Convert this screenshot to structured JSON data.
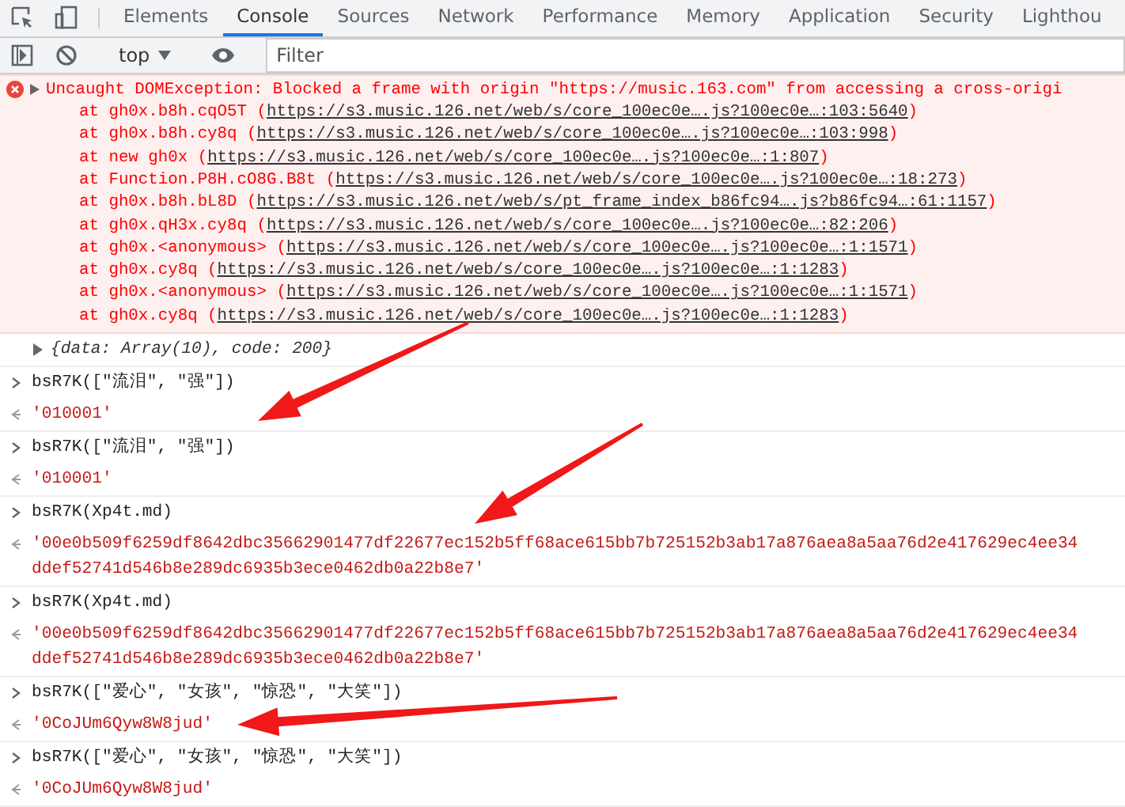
{
  "tabs": [
    {
      "label": "Elements",
      "selected": false
    },
    {
      "label": "Console",
      "selected": true
    },
    {
      "label": "Sources",
      "selected": false
    },
    {
      "label": "Network",
      "selected": false
    },
    {
      "label": "Performance",
      "selected": false
    },
    {
      "label": "Memory",
      "selected": false
    },
    {
      "label": "Application",
      "selected": false
    },
    {
      "label": "Security",
      "selected": false
    },
    {
      "label": "Lighthou",
      "selected": false
    }
  ],
  "toolbar": {
    "context": "top",
    "filter": {
      "placeholder": "Filter"
    }
  },
  "error": {
    "message": "Uncaught DOMException: Blocked a frame with origin \"https://music.163.com\" from accessing a cross-origi",
    "stack": [
      {
        "at": "at gh0x.b8h.cqO5T (",
        "link": "https://s3.music.126.net/web/s/core_100ec0e….js?100ec0e…:103:5640",
        "close": ")"
      },
      {
        "at": "at gh0x.b8h.cy8q (",
        "link": "https://s3.music.126.net/web/s/core_100ec0e….js?100ec0e…:103:998",
        "close": ")"
      },
      {
        "at": "at new gh0x (",
        "link": "https://s3.music.126.net/web/s/core_100ec0e….js?100ec0e…:1:807",
        "close": ")"
      },
      {
        "at": "at Function.P8H.cO8G.B8t (",
        "link": "https://s3.music.126.net/web/s/core_100ec0e….js?100ec0e…:18:273",
        "close": ")"
      },
      {
        "at": "at gh0x.b8h.bL8D (",
        "link": "https://s3.music.126.net/web/s/pt_frame_index_b86fc94….js?b86fc94…:61:1157",
        "close": ")"
      },
      {
        "at": "at gh0x.qH3x.cy8q (",
        "link": "https://s3.music.126.net/web/s/core_100ec0e….js?100ec0e…:82:206",
        "close": ")"
      },
      {
        "at": "at gh0x.<anonymous> (",
        "link": "https://s3.music.126.net/web/s/core_100ec0e….js?100ec0e…:1:1571",
        "close": ")"
      },
      {
        "at": "at gh0x.cy8q (",
        "link": "https://s3.music.126.net/web/s/core_100ec0e….js?100ec0e…:1:1283",
        "close": ")"
      },
      {
        "at": "at gh0x.<anonymous> (",
        "link": "https://s3.music.126.net/web/s/core_100ec0e….js?100ec0e…:1:1571",
        "close": ")"
      },
      {
        "at": "at gh0x.cy8q (",
        "link": "https://s3.music.126.net/web/s/core_100ec0e….js?100ec0e…:1:1283",
        "close": ")"
      }
    ]
  },
  "object_log": {
    "text": "{data: Array(10), code: 200}",
    "expanded": false
  },
  "entries": [
    {
      "kind": "input",
      "lines": [
        "bsR7K([\"流泪\", \"强\"])"
      ]
    },
    {
      "kind": "output",
      "lines": [
        "'010001'"
      ]
    },
    {
      "kind": "input",
      "lines": [
        "bsR7K([\"流泪\", \"强\"])"
      ]
    },
    {
      "kind": "output",
      "lines": [
        "'010001'"
      ]
    },
    {
      "kind": "input",
      "lines": [
        "bsR7K(Xp4t.md)"
      ]
    },
    {
      "kind": "output",
      "lines": [
        "'00e0b509f6259df8642dbc35662901477df22677ec152b5ff68ace615bb7b725152b3ab17a876aea8a5aa76d2e417629ec4ee34",
        "ddef52741d546b8e289dc6935b3ece0462db0a22b8e7'"
      ]
    },
    {
      "kind": "input",
      "lines": [
        "bsR7K(Xp4t.md)"
      ]
    },
    {
      "kind": "output",
      "lines": [
        "'00e0b509f6259df8642dbc35662901477df22677ec152b5ff68ace615bb7b725152b3ab17a876aea8a5aa76d2e417629ec4ee34",
        "ddef52741d546b8e289dc6935b3ece0462db0a22b8e7'"
      ]
    },
    {
      "kind": "input",
      "lines": [
        "bsR7K([\"爱心\", \"女孩\", \"惊恐\", \"大笑\"])"
      ]
    },
    {
      "kind": "output",
      "lines": [
        "'0CoJUm6Qyw8W8jud'"
      ]
    },
    {
      "kind": "input",
      "lines": [
        "bsR7K([\"爱心\", \"女孩\", \"惊恐\", \"大笑\"])"
      ]
    },
    {
      "kind": "output",
      "lines": [
        "'0CoJUm6Qyw8W8jud'"
      ]
    }
  ]
}
